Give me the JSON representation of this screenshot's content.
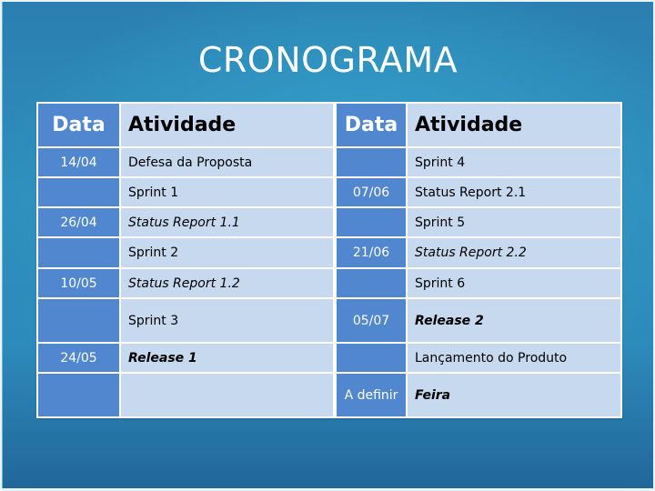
{
  "title": "CRONOGRAMA",
  "colors": {
    "date_cell": "#5187cf",
    "activity_cell": "#c7d9ef",
    "background": "#2f8fbd"
  },
  "table": {
    "headers": [
      "Data",
      "Atividade",
      "Data",
      "Atividade"
    ],
    "rows": [
      {
        "left_date": "14/04",
        "left_activity": "Defesa da Proposta",
        "left_style": "normal",
        "right_date": "",
        "right_activity": "Sprint 4",
        "right_style": "normal"
      },
      {
        "left_date": "",
        "left_activity": "Sprint 1",
        "left_style": "normal",
        "right_date": "07/06",
        "right_activity": "Status Report 2.1",
        "right_style": "normal"
      },
      {
        "left_date": "26/04",
        "left_activity": "Status Report 1.1",
        "left_style": "italic",
        "right_date": "",
        "right_activity": "Sprint 5",
        "right_style": "normal"
      },
      {
        "left_date": "",
        "left_activity": "Sprint 2",
        "left_style": "normal",
        "right_date": "21/06",
        "right_activity": "Status Report 2.2",
        "right_style": "italic"
      },
      {
        "left_date": "10/05",
        "left_activity": "Status Report 1.2",
        "left_style": "italic",
        "right_date": "",
        "right_activity": "Sprint 6",
        "right_style": "normal"
      },
      {
        "left_date": "",
        "left_activity": "Sprint 3",
        "left_style": "normal",
        "right_date": "05/07",
        "right_activity": "Release 2",
        "right_style": "bold-italic"
      },
      {
        "left_date": "24/05",
        "left_activity": "Release 1",
        "left_style": "bold-italic",
        "right_date": "",
        "right_activity": "Lançamento do Produto",
        "right_style": "normal"
      },
      {
        "left_date": "",
        "left_activity": "",
        "left_style": "normal",
        "right_date": "A definir",
        "right_activity": "Feira",
        "right_style": "bold-italic"
      }
    ]
  }
}
